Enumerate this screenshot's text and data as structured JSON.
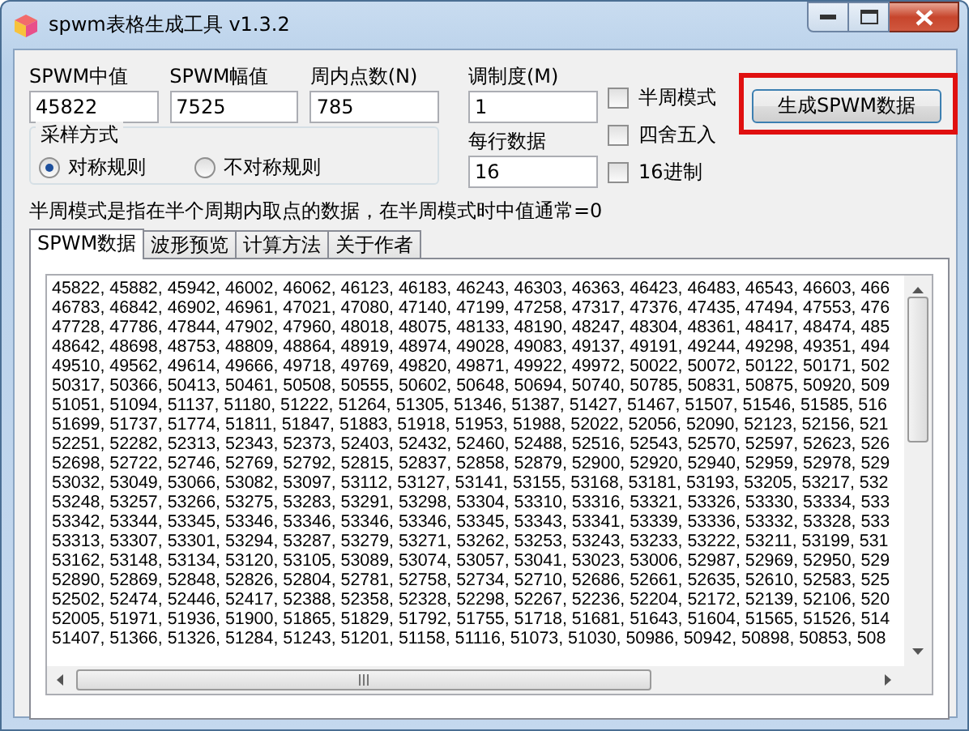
{
  "window": {
    "title": "spwm表格生成工具 v1.3.2"
  },
  "fields": [
    {
      "label": "SPWM中值",
      "value": "45822"
    },
    {
      "label": "SPWM幅值",
      "value": "7525"
    },
    {
      "label": "周内点数(N)",
      "value": "785"
    }
  ],
  "modulation": {
    "label": "调制度(M)",
    "value": "1"
  },
  "per_row": {
    "label": "每行数据",
    "value": "16"
  },
  "sampling": {
    "title": "采样方式",
    "options": [
      {
        "label": "对称规则",
        "selected": true
      },
      {
        "label": "不对称规则",
        "selected": false
      }
    ]
  },
  "options": [
    {
      "label": "半周模式",
      "checked": false
    },
    {
      "label": "四舍五入",
      "checked": false
    },
    {
      "label": "16进制",
      "checked": false
    }
  ],
  "generate_button": "生成SPWM数据",
  "note": "半周模式是指在半个周期内取点的数据，在半周模式时中值通常=0",
  "tabs": [
    {
      "label": "SPWM数据",
      "selected": true
    },
    {
      "label": "波形预览",
      "selected": false
    },
    {
      "label": "计算方法",
      "selected": false
    },
    {
      "label": "关于作者",
      "selected": false
    }
  ],
  "output_lines": [
    "45822, 45882, 45942, 46002, 46062, 46123, 46183, 46243, 46303, 46363, 46423, 46483, 46543, 46603, 466",
    "46783, 46842, 46902, 46961, 47021, 47080, 47140, 47199, 47258, 47317, 47376, 47435, 47494, 47553, 476",
    "47728, 47786, 47844, 47902, 47960, 48018, 48075, 48133, 48190, 48247, 48304, 48361, 48417, 48474, 485",
    "48642, 48698, 48753, 48809, 48864, 48919, 48974, 49028, 49083, 49137, 49191, 49244, 49298, 49351, 494",
    "49510, 49562, 49614, 49666, 49718, 49769, 49820, 49871, 49922, 49972, 50022, 50072, 50122, 50171, 502",
    "50317, 50366, 50413, 50461, 50508, 50555, 50602, 50648, 50694, 50740, 50785, 50831, 50875, 50920, 509",
    "51051, 51094, 51137, 51180, 51222, 51264, 51305, 51346, 51387, 51427, 51467, 51507, 51546, 51585, 516",
    "51699, 51737, 51774, 51811, 51847, 51883, 51918, 51953, 51988, 52022, 52056, 52090, 52123, 52156, 521",
    "52251, 52282, 52313, 52343, 52373, 52403, 52432, 52460, 52488, 52516, 52543, 52570, 52597, 52623, 526",
    "52698, 52722, 52746, 52769, 52792, 52815, 52837, 52858, 52879, 52900, 52920, 52940, 52959, 52978, 529",
    "53032, 53049, 53066, 53082, 53097, 53112, 53127, 53141, 53155, 53168, 53181, 53193, 53205, 53217, 532",
    "53248, 53257, 53266, 53275, 53283, 53291, 53298, 53304, 53310, 53316, 53321, 53326, 53330, 53334, 533",
    "53342, 53344, 53345, 53346, 53346, 53346, 53346, 53345, 53343, 53341, 53339, 53336, 53332, 53328, 533",
    "53313, 53307, 53301, 53294, 53287, 53279, 53271, 53262, 53253, 53243, 53233, 53222, 53211, 53199, 531",
    "53162, 53148, 53134, 53120, 53105, 53089, 53074, 53057, 53041, 53023, 53006, 52987, 52969, 52950, 529",
    "52890, 52869, 52848, 52826, 52804, 52781, 52758, 52734, 52710, 52686, 52661, 52635, 52610, 52583, 525",
    "52502, 52474, 52446, 52417, 52388, 52358, 52328, 52298, 52267, 52236, 52204, 52172, 52139, 52106, 520",
    "52005, 51971, 51936, 51900, 51865, 51829, 51792, 51755, 51718, 51681, 51643, 51604, 51565, 51526, 514",
    "51407, 51366, 51326, 51284, 51243, 51201, 51158, 51116, 51073, 51030, 50986, 50942, 50898, 50853, 508"
  ]
}
